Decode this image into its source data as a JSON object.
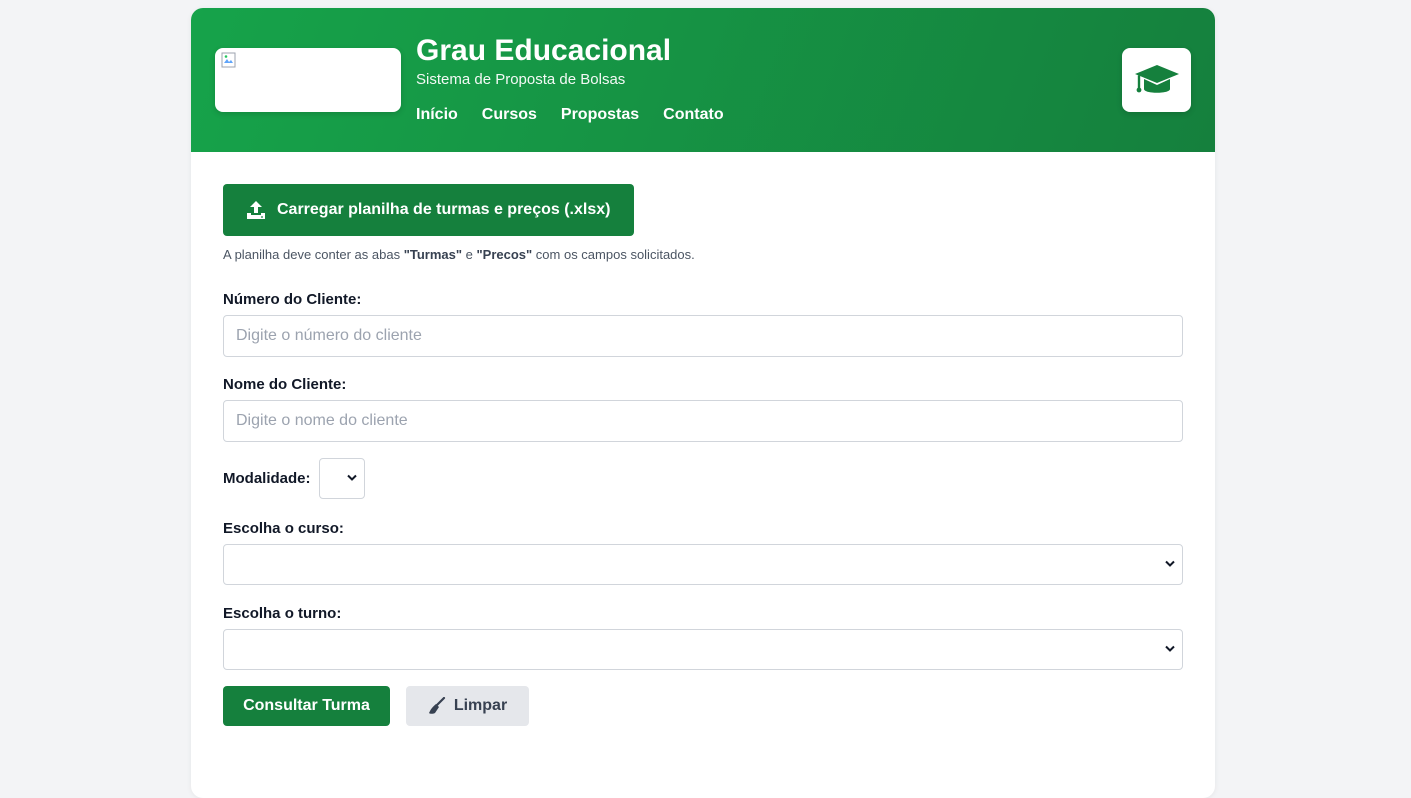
{
  "header": {
    "title": "Grau Educacional",
    "subtitle": "Sistema de Proposta de Bolsas",
    "nav": [
      "Início",
      "Cursos",
      "Propostas",
      "Contato"
    ],
    "logo_icon": "broken-image-icon",
    "cap_icon": "graduation-cap-icon",
    "brand_color": "#16a34a"
  },
  "upload": {
    "label": "Carregar planilha de turmas e preços (.xlsx)",
    "icon": "upload-icon",
    "hint_prefix": "A planilha deve conter as abas ",
    "hint_tab1": "\"Turmas\"",
    "hint_mid": " e ",
    "hint_tab2": "\"Precos\"",
    "hint_suffix": " com os campos solicitados."
  },
  "form": {
    "client_number": {
      "label": "Número do Cliente:",
      "placeholder": "Digite o número do cliente",
      "value": ""
    },
    "client_name": {
      "label": "Nome do Cliente:",
      "placeholder": "Digite o nome do cliente",
      "value": ""
    },
    "modality": {
      "label": "Modalidade:",
      "value": ""
    },
    "course": {
      "label": "Escolha o curso:",
      "value": ""
    },
    "shift": {
      "label": "Escolha o turno:",
      "value": ""
    }
  },
  "actions": {
    "consult_label": "Consultar Turma",
    "clear_label": "Limpar",
    "clear_icon": "broom-icon"
  }
}
